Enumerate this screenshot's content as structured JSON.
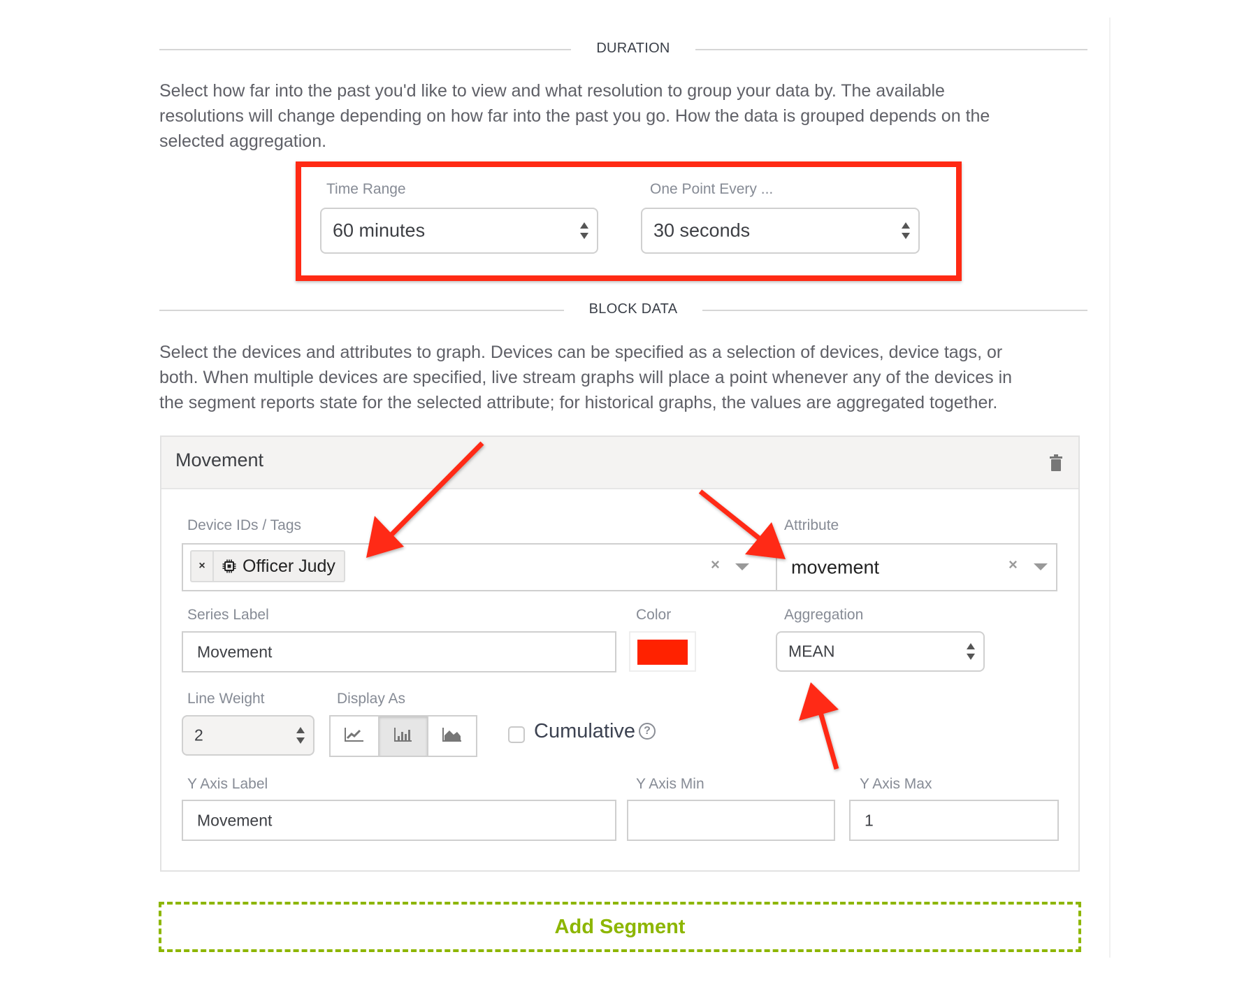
{
  "duration": {
    "section_title": "DURATION",
    "description": "Select how far into the past you'd like to view and what resolution to group your data by. The available resolutions will change depending on how far into the past you go. How the data is grouped depends on the selected aggregation.",
    "description_lines": [
      "Select how far into the past you'd like to view and what resolution to group your data by. The available",
      "resolutions will change depending on how far into the past you go. How the data is grouped depends on the",
      "selected aggregation."
    ],
    "time_range": {
      "label": "Time Range",
      "value": "60 minutes"
    },
    "resolution": {
      "label": "One Point Every ...",
      "value": "30 seconds"
    }
  },
  "block_data": {
    "section_title": "BLOCK DATA",
    "description_lines": [
      "Select the devices and attributes to graph. Devices can be specified as a selection of devices, device tags, or",
      "both. When multiple devices are specified, live stream graphs will place a point whenever any of the devices in",
      "the segment reports state for the selected attribute; for historical graphs, the values are aggregated together."
    ]
  },
  "segment": {
    "title": "Movement",
    "delete_icon": "trash-icon",
    "device_ids": {
      "label": "Device IDs / Tags",
      "chips": [
        {
          "label": "Officer Judy",
          "icon": "chip-icon",
          "remove_symbol": "×"
        }
      ],
      "clear_symbol": "×"
    },
    "attribute": {
      "label": "Attribute",
      "value": "movement",
      "clear_symbol": "×"
    },
    "series_label": {
      "label": "Series Label",
      "value": "Movement"
    },
    "color": {
      "label": "Color",
      "value": "#ff2200"
    },
    "aggregation": {
      "label": "Aggregation",
      "value": "MEAN"
    },
    "line_weight": {
      "label": "Line Weight",
      "value": "2"
    },
    "display_as": {
      "label": "Display As",
      "options": [
        {
          "name": "line",
          "icon": "line-chart-icon",
          "active": false
        },
        {
          "name": "bar",
          "icon": "bar-chart-icon",
          "active": true
        },
        {
          "name": "area",
          "icon": "area-chart-icon",
          "active": false
        }
      ]
    },
    "cumulative": {
      "label": "Cumulative",
      "checked": false,
      "help_symbol": "?"
    },
    "y_axis_label": {
      "label": "Y Axis Label",
      "value": "Movement"
    },
    "y_axis_min": {
      "label": "Y Axis Min",
      "value": ""
    },
    "y_axis_max": {
      "label": "Y Axis Max",
      "value": "1"
    }
  },
  "add_segment_label": "Add Segment",
  "annotation_color": "#ff2a14",
  "accent_color": "#8db600"
}
